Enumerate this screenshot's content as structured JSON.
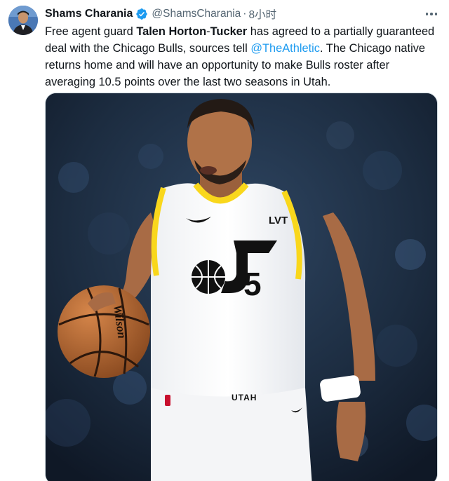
{
  "author": {
    "name": "Shams Charania",
    "handle": "@ShamsCharania",
    "separator": "·",
    "time": "8小时"
  },
  "icons": {
    "verified": "verified-badge-icon",
    "more": "more-options-icon"
  },
  "colors": {
    "link": "#1d9bf0",
    "verified": "#1d9bf0",
    "jersey_trim": "#f9d71c",
    "text_secondary": "#536471"
  },
  "text": {
    "p1": "Free agent guard ",
    "bold1": "Talen Horton",
    "p2": "-",
    "bold2": "Tucker",
    "p3": " has agreed to a partially guaranteed deal with the Chicago Bulls, sources tell ",
    "mention": "@TheAthletic",
    "p4": ". The Chicago native returns home and will have an opportunity to make Bulls roster after averaging 10.5 points over the last two seasons in Utah."
  },
  "media": {
    "jersey_logo": "LVT",
    "jersey_number": "5",
    "shorts_text": "UTAH",
    "ball_text": "Wilson"
  }
}
